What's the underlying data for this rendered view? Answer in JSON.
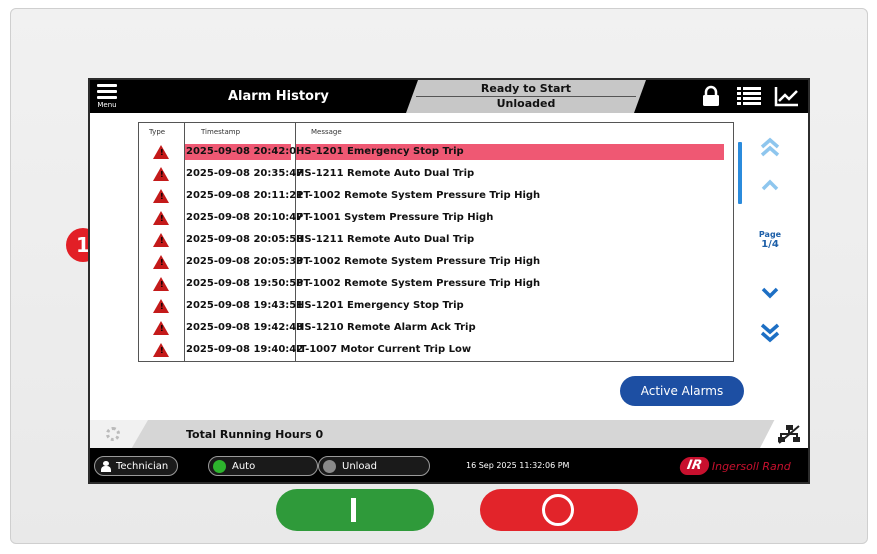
{
  "callout": "1",
  "header": {
    "menu_label": "Menu",
    "title": "Alarm History",
    "status_line1": "Ready to Start",
    "status_line2": "Unloaded",
    "icons": [
      "lock-icon",
      "list-icon",
      "trend-chart-icon"
    ]
  },
  "table": {
    "columns": [
      "Type",
      "Timestamp",
      "Message"
    ],
    "rows": [
      {
        "type": "alarm-triangle-icon",
        "timestamp": "2025-09-08 20:42:07",
        "message": "HS-1201 Emergency Stop Trip",
        "selected": true
      },
      {
        "type": "alarm-triangle-icon",
        "timestamp": "2025-09-08 20:35:47",
        "message": "HS-1211 Remote Auto Dual Trip"
      },
      {
        "type": "alarm-triangle-icon",
        "timestamp": "2025-09-08 20:11:21",
        "message": "PT-1002 Remote System Pressure Trip High"
      },
      {
        "type": "alarm-triangle-icon",
        "timestamp": "2025-09-08 20:10:47",
        "message": "PT-1001 System Pressure Trip High"
      },
      {
        "type": "alarm-triangle-icon",
        "timestamp": "2025-09-08 20:05:58",
        "message": "HS-1211 Remote Auto Dual Trip"
      },
      {
        "type": "alarm-triangle-icon",
        "timestamp": "2025-09-08 20:05:33",
        "message": "PT-1002 Remote System Pressure Trip High"
      },
      {
        "type": "alarm-triangle-icon",
        "timestamp": "2025-09-08 19:50:58",
        "message": "PT-1002 Remote System Pressure Trip High"
      },
      {
        "type": "alarm-triangle-icon",
        "timestamp": "2025-09-08 19:43:51",
        "message": "HS-1201 Emergency Stop Trip"
      },
      {
        "type": "alarm-triangle-icon",
        "timestamp": "2025-09-08 19:42:43",
        "message": "HS-1210 Remote Alarm Ack Trip"
      },
      {
        "type": "alarm-triangle-icon",
        "timestamp": "2025-09-08 19:40:42",
        "message": "IT-1007 Motor Current Trip Low"
      }
    ]
  },
  "pager": {
    "label": "Page",
    "value": "1/4",
    "icons": [
      "double-chevron-up-icon",
      "chevron-up-icon",
      "chevron-down-icon",
      "double-chevron-down-icon"
    ]
  },
  "active_alarms_label": "Active Alarms",
  "running_hours": "Total Running Hours 0",
  "footer": {
    "user": "Technician",
    "mode": "Auto",
    "mode_color": "#2db52d",
    "load": "Unload",
    "load_color": "#8a8a8a",
    "datetime": "16 Sep 2025 11:32:06 PM",
    "brand_mark": "IR",
    "brand_name": "Ingersoll Rand"
  },
  "colors": {
    "accent": "#1d4fa3",
    "alarm": "#c41a1a",
    "selected_row": "#ef5873",
    "start_button": "#2f9a3a",
    "stop_button": "#e2242a"
  }
}
